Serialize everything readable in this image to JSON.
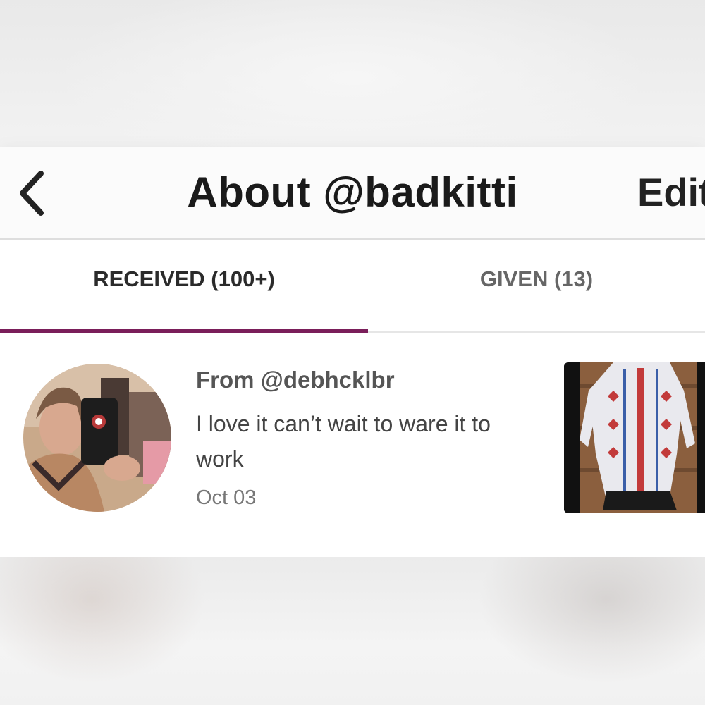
{
  "header": {
    "title": "About @badkitti",
    "edit_label": "Edit"
  },
  "tabs": [
    {
      "label": "RECEIVED (100+)",
      "active": true
    },
    {
      "label": "GIVEN (13)",
      "active": false
    }
  ],
  "reviews": [
    {
      "from": "From @debhcklbr",
      "text": "I love it can’t wait to ware it to work",
      "date": "Oct 03"
    }
  ],
  "colors": {
    "accent": "#7a1e5a",
    "title": "#1a1a1a",
    "inactive_tab": "#666666"
  },
  "icons": {
    "back": "chevron-left-icon"
  }
}
